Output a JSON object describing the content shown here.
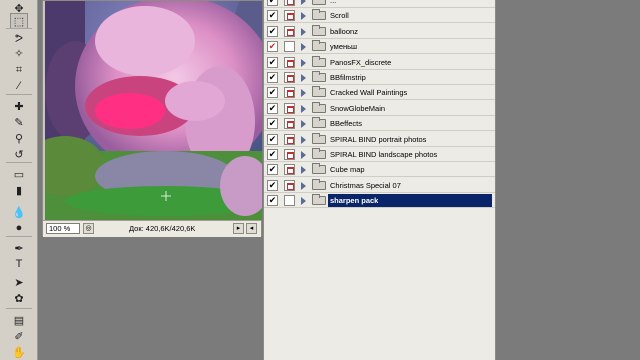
{
  "toolbar": {
    "tools": [
      {
        "name": "move-tool-icon",
        "glyph": "✥",
        "active": false
      },
      {
        "name": "marquee-tool-icon",
        "glyph": "⬚",
        "active": true
      },
      {
        "name": "lasso-tool-icon",
        "glyph": "ᕗ",
        "active": false
      },
      {
        "name": "magic-wand-tool-icon",
        "glyph": "✧",
        "active": false
      },
      {
        "name": "crop-tool-icon",
        "glyph": "⌗",
        "active": false
      },
      {
        "name": "slice-tool-icon",
        "glyph": "⁄",
        "active": false
      },
      {
        "name": "healing-brush-tool-icon",
        "glyph": "✚",
        "active": false
      },
      {
        "name": "brush-tool-icon",
        "glyph": "✎",
        "active": false
      },
      {
        "name": "clone-stamp-tool-icon",
        "glyph": "⚲",
        "active": false
      },
      {
        "name": "history-brush-tool-icon",
        "glyph": "↺",
        "active": false
      },
      {
        "name": "eraser-tool-icon",
        "glyph": "▭",
        "active": false
      },
      {
        "name": "gradient-tool-icon",
        "glyph": "▮",
        "active": false
      },
      {
        "name": "blur-tool-icon",
        "glyph": "💧",
        "active": false
      },
      {
        "name": "dodge-tool-icon",
        "glyph": "●",
        "active": false
      },
      {
        "name": "pen-tool-icon",
        "glyph": "✒",
        "active": false
      },
      {
        "name": "type-tool-icon",
        "glyph": "T",
        "active": false
      },
      {
        "name": "path-selection-tool-icon",
        "glyph": "➤",
        "active": false
      },
      {
        "name": "shape-tool-icon",
        "glyph": "✿",
        "active": false
      },
      {
        "name": "notes-tool-icon",
        "glyph": "▤",
        "active": false
      },
      {
        "name": "eyedropper-tool-icon",
        "glyph": "✐",
        "active": false
      },
      {
        "name": "hand-tool-icon",
        "glyph": "✋",
        "active": false
      }
    ]
  },
  "document": {
    "zoom": "100 %",
    "info": "Док: 420,6K/420,6K"
  },
  "actions_panel": {
    "rows": [
      {
        "label": "...",
        "checked": true,
        "dialog": true,
        "selected": false
      },
      {
        "label": "Scroll",
        "checked": true,
        "dialog": true,
        "selected": false
      },
      {
        "label": "balloonz",
        "checked": true,
        "dialog": true,
        "selected": false
      },
      {
        "label": "уменьш",
        "checked": true,
        "dialog": false,
        "selected": false
      },
      {
        "label": "PanosFX_discrete",
        "checked": true,
        "dialog": true,
        "selected": false
      },
      {
        "label": "BBfilmstrip",
        "checked": true,
        "dialog": true,
        "selected": false
      },
      {
        "label": "Cracked Wall Paintings",
        "checked": true,
        "dialog": true,
        "selected": false
      },
      {
        "label": "SnowGlobeMain",
        "checked": true,
        "dialog": true,
        "selected": false
      },
      {
        "label": "BBeffects",
        "checked": true,
        "dialog": true,
        "selected": false
      },
      {
        "label": "SPIRAL BIND portrait photos",
        "checked": true,
        "dialog": true,
        "selected": false
      },
      {
        "label": "SPIRAL BIND landscape photos",
        "checked": true,
        "dialog": true,
        "selected": false
      },
      {
        "label": "Cube map",
        "checked": true,
        "dialog": true,
        "selected": false
      },
      {
        "label": "Christmas Special 07",
        "checked": true,
        "dialog": true,
        "selected": false
      },
      {
        "label": "sharpen pack",
        "checked": true,
        "dialog": false,
        "selected": true
      }
    ]
  },
  "colors": {
    "selection": "#0a246a",
    "check_red": "#c03030",
    "panel_bg": "#ecebe6",
    "workspace": "#7b7b7b"
  }
}
